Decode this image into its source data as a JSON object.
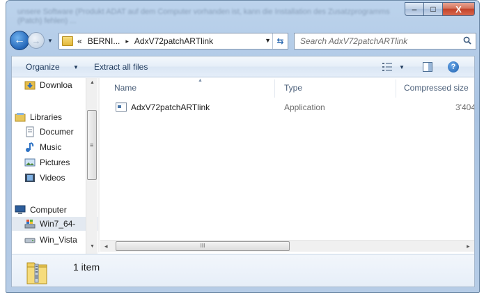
{
  "window": {
    "blurred_title": "unsere Software (Produkt ADAT auf dem Computer vorhanden ist, kann die Installation des Zusatzprogramms (Patch) fehlen) ...",
    "caption": {
      "minimize": "–",
      "maximize": "□",
      "close": "X"
    }
  },
  "nav": {
    "back": "←",
    "forward": "→",
    "dropdown": "▼"
  },
  "address": {
    "prefix": "«",
    "crumbs": [
      "BERNI...",
      "AdxV72patchARTlink"
    ],
    "separator": "▸",
    "dropdown": "▼",
    "refresh": "⇆"
  },
  "search": {
    "placeholder": "Search AdxV72patchARTlink"
  },
  "toolbar": {
    "organize_label": "Organize",
    "organize_arrow": "▼",
    "extract_label": "Extract all files",
    "views_arrow": "▼",
    "help": "?"
  },
  "navpane": {
    "items": [
      {
        "label": "Downloa",
        "icon": "downloads-folder-icon"
      },
      {
        "label": "Libraries",
        "icon": "libraries-icon"
      },
      {
        "label": "Documer",
        "icon": "documents-icon"
      },
      {
        "label": "Music",
        "icon": "music-icon"
      },
      {
        "label": "Pictures",
        "icon": "pictures-icon"
      },
      {
        "label": "Videos",
        "icon": "videos-icon"
      },
      {
        "label": "Computer",
        "icon": "computer-icon"
      },
      {
        "label": "Win7_64-",
        "icon": "windows-drive-icon"
      },
      {
        "label": "Win_Vista",
        "icon": "drive-icon"
      }
    ],
    "scroll_up": "▲",
    "scroll_down": "▼",
    "grip": "≡"
  },
  "filelist": {
    "columns": [
      "Name",
      "Type",
      "Compressed size"
    ],
    "rows": [
      {
        "name": "AdxV72patchARTlink",
        "type": "Application",
        "size": "3'404"
      }
    ]
  },
  "hscroll": {
    "left": "◂",
    "right": "▸",
    "grip": "III"
  },
  "details": {
    "count_text": "1 item"
  },
  "colors": {
    "accent": "#2466b8",
    "window_glass": "#b6cce6",
    "close": "#c2432a"
  }
}
